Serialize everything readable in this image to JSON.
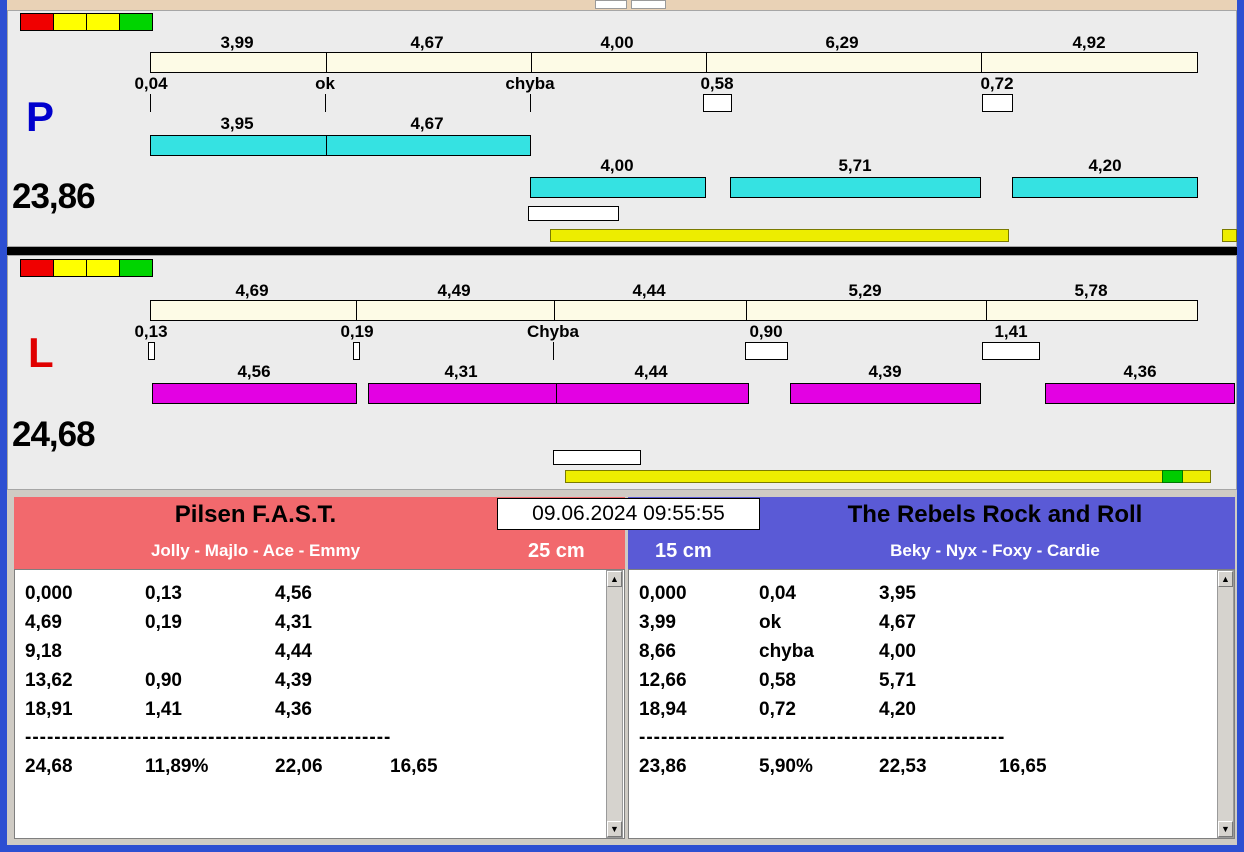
{
  "icons": {
    "scroll_up": "▲",
    "scroll_down": "▼"
  },
  "lane_p": {
    "letter": "P",
    "total": "23,86",
    "splits": [
      "3,99",
      "4,67",
      "4,00",
      "6,29",
      "4,92"
    ],
    "marks": [
      "0,04",
      "ok",
      "chyba",
      "0,58",
      "0,72"
    ],
    "dog_times_row1": [
      "3,95",
      "4,67"
    ],
    "dog_times_row2": [
      "4,00",
      "5,71",
      "4,20"
    ]
  },
  "lane_l": {
    "letter": "L",
    "total": "24,68",
    "splits": [
      "4,69",
      "4,49",
      "4,44",
      "5,29",
      "5,78"
    ],
    "marks": [
      "0,13",
      "0,19",
      "Chyba",
      "0,90",
      "1,41"
    ],
    "dog_times": [
      "4,56",
      "4,31",
      "4,44",
      "4,39",
      "4,36"
    ]
  },
  "clock": "09.06.2024 09:55:55",
  "left_team": {
    "name": "Pilsen F.A.S.T.",
    "dogs": "Jolly - Majlo - Ace - Emmy",
    "jump_height": "25 cm",
    "rows": [
      [
        "0,000",
        "0,13",
        "4,56"
      ],
      [
        "4,69",
        "0,19",
        "4,31"
      ],
      [
        "9,18",
        "",
        "4,44"
      ],
      [
        "13,62",
        "0,90",
        "4,39"
      ],
      [
        "18,91",
        "1,41",
        "4,36"
      ]
    ],
    "separator": "--------------------------------------------------",
    "totals": [
      "24,68",
      "11,89%",
      "22,06",
      "16,65"
    ]
  },
  "right_team": {
    "name": "The Rebels Rock and Roll",
    "dogs": "Beky - Nyx - Foxy - Cardie",
    "jump_height": "15 cm",
    "rows": [
      [
        "0,000",
        "0,04",
        "3,95"
      ],
      [
        "3,99",
        "ok",
        "4,67"
      ],
      [
        "8,66",
        "chyba",
        "4,00"
      ],
      [
        "12,66",
        "0,58",
        "5,71"
      ],
      [
        "18,94",
        "0,72",
        "4,20"
      ]
    ],
    "separator": "--------------------------------------------------",
    "totals": [
      "23,86",
      "5,90%",
      "22,53",
      "16,65"
    ]
  },
  "colors": {
    "lane_p_bar_cyan": "#35e2e2",
    "lane_l_bar_magenta": "#e301e3",
    "progress_yellow": "#eded00",
    "left_header_salmon": "#f2696d",
    "right_header_blue": "#5a5ad6",
    "window_border_blue": "#2d4fd2",
    "traffic_red": "#f00000",
    "traffic_yellow": "#ffff00",
    "traffic_green": "#00d400"
  }
}
